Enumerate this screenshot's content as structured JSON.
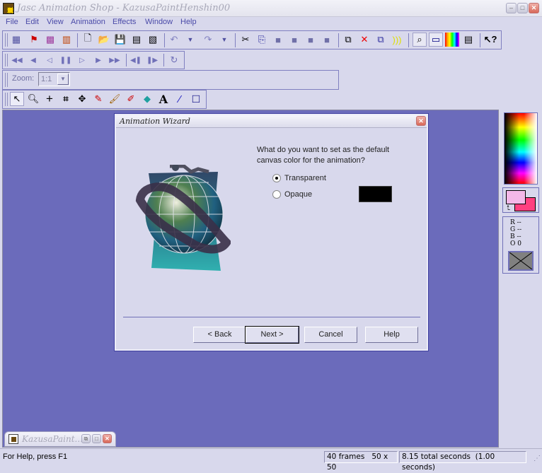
{
  "window": {
    "title": "Jasc Animation Shop - KazusaPaintHenshin00"
  },
  "menu": [
    "File",
    "Edit",
    "View",
    "Animation",
    "Effects",
    "Window",
    "Help"
  ],
  "toolbar_main": {
    "icons": [
      "animation-wizard-icon",
      "banner-wizard-icon",
      "image-wizard-icon",
      "optimization-wizard-icon",
      "new-icon",
      "open-icon",
      "save-icon",
      "save-as-icon",
      "browse-icon",
      "undo-icon",
      "undo-dropdown-icon",
      "redo-icon",
      "redo-dropdown-icon",
      "cut-icon",
      "copy-icon",
      "copy-frame-icon",
      "paste-as-new-icon",
      "paste-before-icon",
      "paste-after-icon",
      "insert-frames-icon",
      "delete-frames-icon",
      "duplicate-frames-icon",
      "transition-icon",
      "zoom-view-icon",
      "frame-properties-icon",
      "palette-icon",
      "vcr-icon",
      "context-help-icon"
    ]
  },
  "toolbar_vcr": {
    "icons": [
      "first-frame-icon",
      "previous-frame-icon",
      "step-back-icon",
      "pause-icon",
      "step-forward-icon",
      "next-frame-icon",
      "last-frame-icon",
      "previous-keyframe-icon",
      "next-keyframe-icon",
      "loop-icon"
    ]
  },
  "zoom_bar": {
    "label": "Zoom:",
    "value": "1:1"
  },
  "toolbar_tools": {
    "icons": [
      "arrow-tool-icon",
      "zoom-tool-icon",
      "crosshair-tool-icon",
      "crop-tool-icon",
      "move-tool-icon",
      "dropper-tool-icon",
      "paintbrush-tool-icon",
      "eraser-tool-icon",
      "fill-tool-icon",
      "text-tool-icon",
      "line-tool-icon",
      "rectangle-tool-icon"
    ]
  },
  "dialog": {
    "title": "Animation Wizard",
    "question": "What do you want to set as the default canvas color for the animation?",
    "options": [
      {
        "label": "Transparent",
        "selected": true
      },
      {
        "label": "Opaque",
        "selected": false
      }
    ],
    "opaque_color": "#000000",
    "buttons": {
      "back": "< Back",
      "next": "Next >",
      "cancel": "Cancel",
      "help": "Help"
    }
  },
  "color_panel": {
    "foreground": "#f4b8e8",
    "background": "#ff4080",
    "rgbo": {
      "r": "R --",
      "g": "G --",
      "b": "B --",
      "o": "O 0"
    }
  },
  "minimized_doc": {
    "title": "KazusaPaint..."
  },
  "status": {
    "help": "For Help, press F1",
    "frames": "40 frames",
    "size": "50 x 50",
    "duration": "8.15 total seconds",
    "frame_duration": "(1.00 seconds)"
  },
  "colors": {
    "workspace": "#6b6bbb",
    "accent": "#4a4aa8"
  }
}
